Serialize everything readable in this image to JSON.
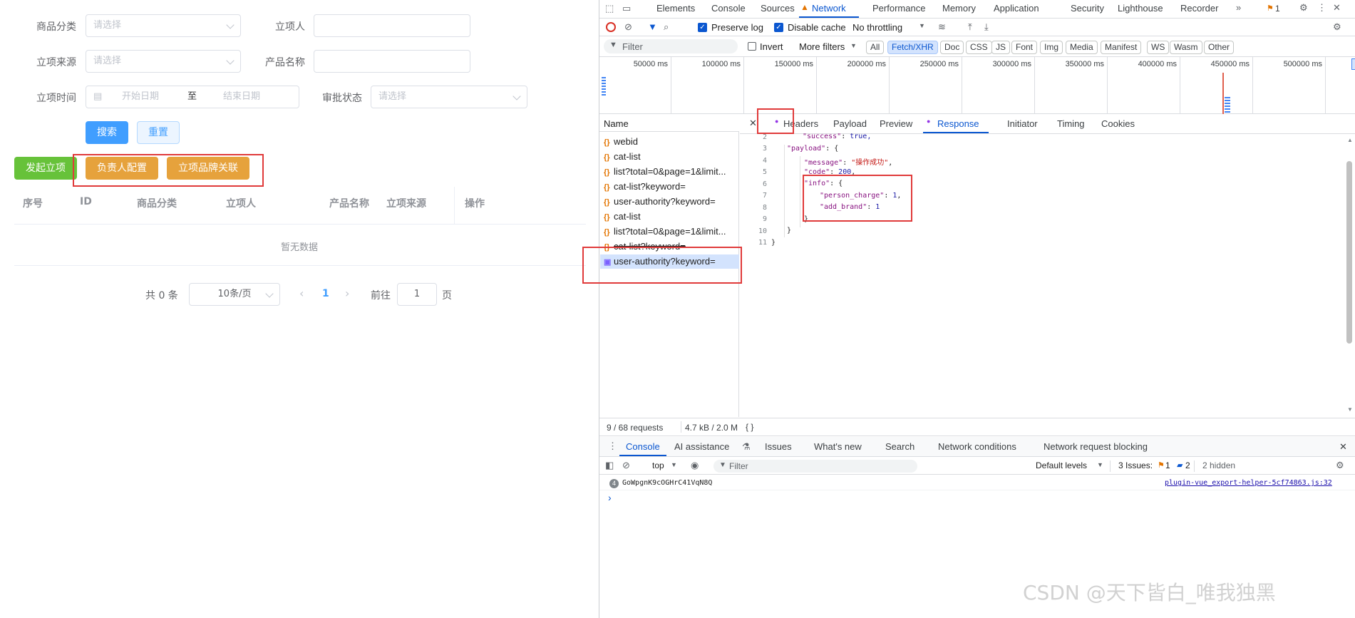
{
  "app": {
    "filters": {
      "category_label": "商品分类",
      "category_placeholder": "请选择",
      "initiator_label": "立项人",
      "source_label": "立项来源",
      "source_placeholder": "请选择",
      "product_name_label": "产品名称",
      "time_label": "立项时间",
      "start_placeholder": "开始日期",
      "range_sep": "至",
      "end_placeholder": "结束日期",
      "approval_label": "审批状态",
      "approval_placeholder": "请选择"
    },
    "buttons": {
      "search": "搜索",
      "reset": "重置",
      "create": "发起立项",
      "owner_config": "负责人配置",
      "brand_link": "立项品牌关联"
    },
    "table": {
      "columns": [
        "序号",
        "ID",
        "商品分类",
        "立项人",
        "产品名称",
        "立项来源",
        "操作"
      ],
      "empty_text": "暂无数据"
    },
    "pagination": {
      "total": "共 0 条",
      "page_size": "10条/页",
      "current_page": "1",
      "goto_label": "前往",
      "goto_value": "1",
      "page_suffix": "页"
    }
  },
  "devtools": {
    "main_tabs": [
      "Elements",
      "Console",
      "Sources",
      "Network",
      "Performance",
      "Memory",
      "Application",
      "Security",
      "Lighthouse",
      "Recorder"
    ],
    "active_tab": "Network",
    "issues_badge": "1",
    "toolbar": {
      "preserve_log": "Preserve log",
      "disable_cache": "Disable cache",
      "throttling": "No throttling"
    },
    "filter_bar": {
      "filter_placeholder": "Filter",
      "invert": "Invert",
      "more_filters": "More filters",
      "chips": [
        "All",
        "Fetch/XHR",
        "Doc",
        "CSS",
        "JS",
        "Font",
        "Img",
        "Media",
        "Manifest",
        "WS",
        "Wasm",
        "Other"
      ],
      "active_chip": "Fetch/XHR"
    },
    "timeline_ticks": [
      "50000 ms",
      "100000 ms",
      "150000 ms",
      "200000 ms",
      "250000 ms",
      "300000 ms",
      "350000 ms",
      "400000 ms",
      "450000 ms",
      "500000 ms"
    ],
    "name_header": "Name",
    "requests": [
      "webid",
      "cat-list",
      "list?total=0&page=1&limit...",
      "cat-list?keyword=",
      "user-authority?keyword=",
      "cat-list",
      "list?total=0&page=1&limit...",
      "cat-list?keyword=",
      "user-authority?keyword="
    ],
    "detail_tabs": [
      "Headers",
      "Payload",
      "Preview",
      "Response",
      "Initiator",
      "Timing",
      "Cookies"
    ],
    "active_detail_tab": "Response",
    "response": {
      "line_numbers": [
        "2",
        "3",
        "4",
        "5",
        "6",
        "7",
        "8",
        "9",
        "10",
        "11"
      ],
      "success_key": "\"success\"",
      "success_val": "true,",
      "payload_key": "\"payload\"",
      "message_key": "\"message\"",
      "message_val": "\"操作成功\"",
      "code_key": "\"code\"",
      "code_val": "200",
      "info_key": "\"info\"",
      "person_key": "\"person_charge\"",
      "person_val": "1",
      "brand_key": "\"add_brand\"",
      "brand_val": "1"
    },
    "status_bar": {
      "requests": "9 / 68 requests",
      "size": "4.7 kB / 2.0 M",
      "format": "{ }"
    },
    "drawer_tabs": [
      "Console",
      "AI assistance",
      "Issues",
      "What's new",
      "Search",
      "Network conditions",
      "Network request blocking"
    ],
    "console_toolbar": {
      "context": "top",
      "filter_placeholder": "Filter",
      "levels": "Default levels",
      "issues_label": "3 Issues:",
      "issues_warn": "1",
      "issues_info": "2",
      "hidden": "2 hidden"
    },
    "console_log": {
      "count": "4",
      "message": "GoWpgnK9cOGHrC41VqN8Q",
      "source": "plugin-vue_export-helper-5cf74863.js:32"
    },
    "prompt": "›"
  },
  "watermark": "CSDN @天下皆白_唯我独黑",
  "colors": {
    "primary": "#409eff",
    "success": "#67c23a",
    "warning": "#e6a23c",
    "annotation_red": "#e03a3a",
    "devtools_blue": "#0b57d0"
  }
}
